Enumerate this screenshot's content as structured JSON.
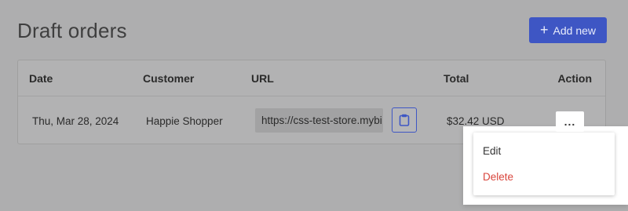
{
  "page": {
    "title": "Draft orders",
    "add_button_label": "Add new",
    "add_button_icon": "plus-icon"
  },
  "colors": {
    "primary": "#3e56c4",
    "danger": "#d9453c",
    "overlay_background": "#aeaeaf"
  },
  "table": {
    "columns": [
      "Date",
      "Customer",
      "URL",
      "Total",
      "Action"
    ],
    "rows": [
      {
        "date": "Thu, Mar 28, 2024",
        "customer": "Happie Shopper",
        "url": "https://css-test-store.mybi",
        "total": "$32.42 USD",
        "copy_icon": "clipboard-icon",
        "action_label": "..."
      }
    ]
  },
  "action_menu": {
    "items": [
      "Edit",
      "Delete"
    ]
  }
}
